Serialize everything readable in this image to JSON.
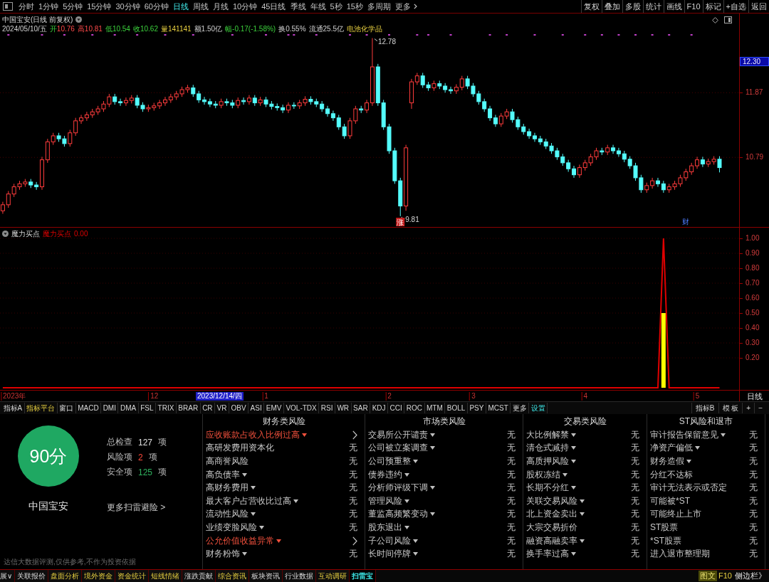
{
  "toolbar": {
    "periods": [
      {
        "label": "分时",
        "selected": false
      },
      {
        "label": "1分钟",
        "selected": false
      },
      {
        "label": "5分钟",
        "selected": false
      },
      {
        "label": "15分钟",
        "selected": false
      },
      {
        "label": "30分钟",
        "selected": false
      },
      {
        "label": "60分钟",
        "selected": false
      },
      {
        "label": "日线",
        "selected": true
      },
      {
        "label": "周线",
        "selected": false
      },
      {
        "label": "月线",
        "selected": false
      },
      {
        "label": "10分钟",
        "selected": false
      },
      {
        "label": "45日线",
        "selected": false
      },
      {
        "label": "季线",
        "selected": false
      },
      {
        "label": "年线",
        "selected": false
      },
      {
        "label": "5秒",
        "selected": false
      },
      {
        "label": "15秒",
        "selected": false
      },
      {
        "label": "多周期",
        "selected": false
      }
    ],
    "more": "更多",
    "actions": [
      "复权",
      "叠加",
      "多股",
      "统计",
      "画线",
      "F10",
      "标记",
      "+自选",
      "返回"
    ]
  },
  "stock_chart": {
    "title": "中国宝安(日线 前复权)",
    "quote": [
      {
        "value": "2024/05/10/五",
        "kind": "neutral"
      },
      {
        "label": "开",
        "value": "10.76",
        "kind": "open"
      },
      {
        "label": "高",
        "value": "10.81",
        "kind": "up"
      },
      {
        "label": "低",
        "value": "10.54",
        "kind": "down"
      },
      {
        "label": "收",
        "value": "10.62",
        "kind": "down"
      },
      {
        "label": "量",
        "value": "141141",
        "kind": "volume"
      },
      {
        "label": "额",
        "value": "1.50亿",
        "kind": "neutral"
      },
      {
        "label": "幅",
        "value": "-0.17(-1.58%)",
        "kind": "down"
      },
      {
        "label": "换",
        "value": "0.55%",
        "kind": "neutral"
      },
      {
        "label": "流通",
        "value": "25.5亿",
        "kind": "neutral"
      },
      {
        "value": "电池化学品",
        "kind": "sector"
      }
    ],
    "price_readout": "12.30",
    "chart_data": [
      {
        "type": "candlestick",
        "ylim": [
          9.63,
          13.19
        ],
        "yticks": [
          11.87,
          10.79
        ],
        "grid": true,
        "annotations": [
          "12.78",
          "9.81",
          "涨",
          "财"
        ],
        "ohlc": [
          [
            9.9,
            10.05,
            9.85,
            10.0
          ],
          [
            10.0,
            10.23,
            9.95,
            10.18
          ],
          [
            10.18,
            10.35,
            10.13,
            10.3
          ],
          [
            10.3,
            10.4,
            10.25,
            10.35
          ],
          [
            10.35,
            10.43,
            10.3,
            10.38
          ],
          [
            10.38,
            10.43,
            10.28,
            10.33
          ],
          [
            10.33,
            10.38,
            10.25,
            10.3
          ],
          [
            10.3,
            10.8,
            10.25,
            10.75
          ],
          [
            10.75,
            11.1,
            10.7,
            11.05
          ],
          [
            11.05,
            11.2,
            11.0,
            11.15
          ],
          [
            11.15,
            11.2,
            11.05,
            11.1
          ],
          [
            11.1,
            11.15,
            10.97,
            11.02
          ],
          [
            11.02,
            11.25,
            10.97,
            11.2
          ],
          [
            11.2,
            11.45,
            11.15,
            11.4
          ],
          [
            11.4,
            11.5,
            11.35,
            11.45
          ],
          [
            11.45,
            11.55,
            11.4,
            11.5
          ],
          [
            11.5,
            11.6,
            11.45,
            11.55
          ],
          [
            11.55,
            11.65,
            11.5,
            11.6
          ],
          [
            11.6,
            11.73,
            11.55,
            11.68
          ],
          [
            11.68,
            11.85,
            11.63,
            11.8
          ],
          [
            11.8,
            11.85,
            11.67,
            11.72
          ],
          [
            11.72,
            11.77,
            11.65,
            11.7
          ],
          [
            11.7,
            11.79,
            11.65,
            11.74
          ],
          [
            11.74,
            11.83,
            11.69,
            11.78
          ],
          [
            11.78,
            11.83,
            11.61,
            11.66
          ],
          [
            11.66,
            11.71,
            11.55,
            11.6
          ],
          [
            11.6,
            11.67,
            11.55,
            11.62
          ],
          [
            11.62,
            11.7,
            11.57,
            11.65
          ],
          [
            11.65,
            11.75,
            11.6,
            11.7
          ],
          [
            11.7,
            11.8,
            11.65,
            11.75
          ],
          [
            11.75,
            11.85,
            11.7,
            11.8
          ],
          [
            11.8,
            11.9,
            11.75,
            11.85
          ],
          [
            11.85,
            11.97,
            11.8,
            11.92
          ],
          [
            11.92,
            12.0,
            11.87,
            11.95
          ],
          [
            11.95,
            12.0,
            11.8,
            11.85
          ],
          [
            11.85,
            11.9,
            11.7,
            11.75
          ],
          [
            11.75,
            11.8,
            11.67,
            11.72
          ],
          [
            11.72,
            11.77,
            11.63,
            11.68
          ],
          [
            11.68,
            11.73,
            11.61,
            11.66
          ],
          [
            11.66,
            11.77,
            11.61,
            11.72
          ],
          [
            11.72,
            11.77,
            11.65,
            11.7
          ],
          [
            11.7,
            11.75,
            11.61,
            11.66
          ],
          [
            11.66,
            11.79,
            11.61,
            11.74
          ],
          [
            11.74,
            11.79,
            11.67,
            11.72
          ],
          [
            11.72,
            11.83,
            11.67,
            11.78
          ],
          [
            11.78,
            11.83,
            11.65,
            11.7
          ],
          [
            11.7,
            11.8,
            11.65,
            11.75
          ],
          [
            11.75,
            11.8,
            11.63,
            11.68
          ],
          [
            11.68,
            11.73,
            11.59,
            11.64
          ],
          [
            11.64,
            11.69,
            11.57,
            11.62
          ],
          [
            11.62,
            11.67,
            11.53,
            11.58
          ],
          [
            11.58,
            11.71,
            11.53,
            11.66
          ],
          [
            11.66,
            11.71,
            11.6,
            11.65
          ],
          [
            11.65,
            11.75,
            11.6,
            11.7
          ],
          [
            11.7,
            11.81,
            11.65,
            11.76
          ],
          [
            11.76,
            11.81,
            11.67,
            11.72
          ],
          [
            11.72,
            11.77,
            11.63,
            11.68
          ],
          [
            11.68,
            11.73,
            11.55,
            11.6
          ],
          [
            11.6,
            11.65,
            11.47,
            11.52
          ],
          [
            11.52,
            11.57,
            11.4,
            11.45
          ],
          [
            11.45,
            11.5,
            11.25,
            11.3
          ],
          [
            11.3,
            11.35,
            11.1,
            11.15
          ],
          [
            11.15,
            11.45,
            11.1,
            11.4
          ],
          [
            11.4,
            11.65,
            11.35,
            11.6
          ],
          [
            11.6,
            11.65,
            11.53,
            11.58
          ],
          [
            11.58,
            11.75,
            11.53,
            11.7
          ],
          [
            11.7,
            12.78,
            11.65,
            12.3
          ],
          [
            12.3,
            12.35,
            11.65,
            11.7
          ],
          [
            11.7,
            11.75,
            11.25,
            11.3
          ],
          [
            11.3,
            11.35,
            10.85,
            10.9
          ],
          [
            10.9,
            10.95,
            10.35,
            10.4
          ],
          [
            10.4,
            10.45,
            9.81,
            9.98
          ],
          [
            9.98,
            11.0,
            9.9,
            10.95
          ],
          [
            11.7,
            12.1,
            11.6,
            12.05
          ],
          [
            12.05,
            12.2,
            12.0,
            12.15
          ],
          [
            12.15,
            12.2,
            11.95,
            12.0
          ],
          [
            12.0,
            12.05,
            11.9,
            11.95
          ],
          [
            11.95,
            12.07,
            11.9,
            12.02
          ],
          [
            12.02,
            12.07,
            11.93,
            11.98
          ],
          [
            11.98,
            12.03,
            11.87,
            11.92
          ],
          [
            11.92,
            11.97,
            11.85,
            11.9
          ],
          [
            11.9,
            12.01,
            11.85,
            11.96
          ],
          [
            11.96,
            12.15,
            11.91,
            12.1
          ],
          [
            12.1,
            12.15,
            11.93,
            11.98
          ],
          [
            11.98,
            12.03,
            11.8,
            11.85
          ],
          [
            11.85,
            11.9,
            11.67,
            11.72
          ],
          [
            11.72,
            11.77,
            11.55,
            11.6
          ],
          [
            11.6,
            11.65,
            11.4,
            11.45
          ],
          [
            11.45,
            11.5,
            11.3,
            11.35
          ],
          [
            11.35,
            11.53,
            11.3,
            11.48
          ],
          [
            11.48,
            11.6,
            11.43,
            11.55
          ],
          [
            11.55,
            11.6,
            11.37,
            11.42
          ],
          [
            11.42,
            11.47,
            11.25,
            11.3
          ],
          [
            11.3,
            11.35,
            11.17,
            11.22
          ],
          [
            11.22,
            11.27,
            11.1,
            11.15
          ],
          [
            11.15,
            11.2,
            11.05,
            11.1
          ],
          [
            11.1,
            11.15,
            11.0,
            11.05
          ],
          [
            11.05,
            11.1,
            10.93,
            10.98
          ],
          [
            10.98,
            11.03,
            10.85,
            10.9
          ],
          [
            10.9,
            10.95,
            10.75,
            10.8
          ],
          [
            10.8,
            10.85,
            10.65,
            10.7
          ],
          [
            10.7,
            10.75,
            10.55,
            10.6
          ],
          [
            10.6,
            10.65,
            10.45,
            10.5
          ],
          [
            10.5,
            10.67,
            10.45,
            10.62
          ],
          [
            10.62,
            10.75,
            10.57,
            10.7
          ],
          [
            10.7,
            10.85,
            10.65,
            10.8
          ],
          [
            10.8,
            10.95,
            10.75,
            10.9
          ],
          [
            10.9,
            10.95,
            10.83,
            10.88
          ],
          [
            10.88,
            11.0,
            10.83,
            10.95
          ],
          [
            10.95,
            11.0,
            10.85,
            10.9
          ],
          [
            10.9,
            10.95,
            10.8,
            10.85
          ],
          [
            10.85,
            10.9,
            10.71,
            10.76
          ],
          [
            10.76,
            10.81,
            10.6,
            10.65
          ],
          [
            10.65,
            10.7,
            10.4,
            10.45
          ],
          [
            10.45,
            10.5,
            10.2,
            10.25
          ],
          [
            10.25,
            10.37,
            10.2,
            10.32
          ],
          [
            10.32,
            10.45,
            10.27,
            10.4
          ],
          [
            10.4,
            10.45,
            10.3,
            10.35
          ],
          [
            10.35,
            10.4,
            10.2,
            10.25
          ],
          [
            10.25,
            10.35,
            10.2,
            10.3
          ],
          [
            10.3,
            10.4,
            10.25,
            10.35
          ],
          [
            10.35,
            10.5,
            10.3,
            10.45
          ],
          [
            10.45,
            10.6,
            10.4,
            10.55
          ],
          [
            10.55,
            10.7,
            10.5,
            10.65
          ],
          [
            10.65,
            10.8,
            10.6,
            10.75
          ],
          [
            10.75,
            10.8,
            10.63,
            10.68
          ],
          [
            10.68,
            10.77,
            10.63,
            10.72
          ],
          [
            10.72,
            10.81,
            10.67,
            10.76
          ],
          [
            10.76,
            10.81,
            10.54,
            10.62
          ],
          null,
          null,
          null
        ]
      }
    ]
  },
  "indicator": {
    "title": "魔力买点",
    "reading": "0.00",
    "cursor_date": "2023/12/14/四",
    "axis_period": "日线",
    "chart_data": [
      {
        "type": "line",
        "ylim": [
          0,
          1.07
        ],
        "grid": true,
        "yticks": [
          {
            "value": 1,
            "label": "1.00"
          },
          {
            "value": 0.9,
            "label": "0.90"
          },
          {
            "value": 0.8,
            "label": "0.80"
          },
          {
            "value": 0.7,
            "label": "0.70"
          },
          {
            "value": 0.6,
            "label": "0.60"
          },
          {
            "value": 0.5,
            "label": "0.50"
          },
          {
            "value": 0.4,
            "label": "0.40"
          },
          {
            "value": 0.3,
            "label": "0.30"
          },
          {
            "value": 0.2,
            "label": "0.20"
          }
        ],
        "categories": [
          null,
          null,
          "2023年",
          null,
          null,
          null,
          null,
          null,
          null,
          null,
          null,
          null,
          null,
          null,
          null,
          null,
          null,
          null,
          null,
          null,
          null,
          null,
          null,
          null,
          null,
          null,
          null,
          "12",
          null,
          null,
          null,
          null,
          null,
          null,
          null,
          null,
          null,
          null,
          null,
          null,
          null,
          null,
          null,
          null,
          null,
          null,
          null,
          "1",
          null,
          null,
          null,
          null,
          null,
          null,
          null,
          null,
          null,
          null,
          null,
          null,
          null,
          null,
          null,
          null,
          null,
          null,
          null,
          null,
          null,
          "2",
          null,
          null,
          null,
          null,
          null,
          null,
          null,
          null,
          null,
          null,
          null,
          null,
          null,
          null,
          "3",
          null,
          null,
          null,
          null,
          null,
          null,
          null,
          null,
          null,
          null,
          null,
          null,
          null,
          null,
          null,
          null,
          null,
          null,
          null,
          "4",
          null,
          null,
          null,
          null,
          null,
          null,
          null,
          null,
          null,
          null,
          null,
          null,
          null,
          null,
          null,
          null,
          null,
          null,
          null,
          "5",
          null,
          null,
          null,
          null,
          null,
          null,
          null
        ],
        "series": [
          {
            "name": "魔力买点",
            "color": "#e00000",
            "values": [
              0,
              0,
              0,
              0,
              0,
              0,
              0,
              0,
              0,
              0,
              0,
              0,
              0,
              0,
              0,
              0,
              0,
              0,
              0,
              0,
              0,
              0,
              0,
              0,
              0,
              0,
              0,
              0,
              0,
              0,
              0,
              0,
              0,
              0,
              0,
              0,
              0,
              0,
              0,
              0,
              0,
              0,
              0,
              0,
              0,
              0,
              0,
              0,
              0,
              0,
              0,
              0,
              0,
              0,
              0,
              0,
              0,
              0,
              0,
              0,
              0,
              0,
              0,
              0,
              0,
              0,
              0,
              0,
              0,
              0,
              0,
              0,
              0,
              0,
              0,
              0,
              0,
              0,
              0,
              0,
              0,
              0,
              0,
              0,
              0,
              0,
              0,
              0,
              0,
              0,
              0,
              0,
              0,
              0,
              0,
              0,
              0,
              0,
              0,
              0,
              0,
              0,
              0,
              0,
              0,
              0,
              0,
              0,
              0,
              0,
              0,
              0,
              0,
              0,
              0,
              0,
              0,
              0,
              1,
              0,
              0,
              0,
              0,
              0,
              0,
              0,
              0,
              0,
              0,
              null,
              null,
              null
            ]
          },
          {
            "type": "bar",
            "color": "#ffff00",
            "values": [
              null,
              null,
              null,
              null,
              null,
              null,
              null,
              null,
              null,
              null,
              null,
              null,
              null,
              null,
              null,
              null,
              null,
              null,
              null,
              null,
              null,
              null,
              null,
              null,
              null,
              null,
              null,
              null,
              null,
              null,
              null,
              null,
              null,
              null,
              null,
              null,
              null,
              null,
              null,
              null,
              null,
              null,
              null,
              null,
              null,
              null,
              null,
              null,
              null,
              null,
              null,
              null,
              null,
              null,
              null,
              null,
              null,
              null,
              null,
              null,
              null,
              null,
              null,
              null,
              null,
              null,
              null,
              null,
              null,
              null,
              null,
              null,
              null,
              null,
              null,
              null,
              null,
              null,
              null,
              null,
              null,
              null,
              null,
              null,
              null,
              null,
              null,
              null,
              null,
              null,
              null,
              null,
              null,
              null,
              null,
              null,
              null,
              null,
              null,
              null,
              null,
              null,
              null,
              null,
              null,
              null,
              null,
              null,
              null,
              null,
              null,
              null,
              null,
              null,
              null,
              null,
              null,
              null,
              0.5,
              null,
              null,
              null,
              null,
              null,
              null,
              null,
              null,
              null,
              null,
              null,
              null,
              null
            ]
          }
        ]
      }
    ]
  },
  "indicator_tabs": {
    "left": [
      {
        "label": "指标A",
        "kind": "plain"
      },
      {
        "label": "指标平台",
        "kind": "highlight"
      },
      {
        "label": "窗口",
        "kind": "plain"
      },
      {
        "label": "MACD",
        "kind": "plain"
      },
      {
        "label": "DMI",
        "kind": "plain"
      },
      {
        "label": "DMA",
        "kind": "plain"
      },
      {
        "label": "FSL",
        "kind": "plain"
      },
      {
        "label": "TRIX",
        "kind": "plain"
      },
      {
        "label": "BRAR",
        "kind": "plain"
      },
      {
        "label": "CR",
        "kind": "plain"
      },
      {
        "label": "VR",
        "kind": "plain"
      },
      {
        "label": "OBV",
        "kind": "plain"
      },
      {
        "label": "ASI",
        "kind": "plain"
      },
      {
        "label": "EMV",
        "kind": "plain"
      },
      {
        "label": "VOL-TDX",
        "kind": "plain"
      },
      {
        "label": "RSI",
        "kind": "plain"
      },
      {
        "label": "WR",
        "kind": "plain"
      },
      {
        "label": "SAR",
        "kind": "plain"
      },
      {
        "label": "KDJ",
        "kind": "plain"
      },
      {
        "label": "CCI",
        "kind": "plain"
      },
      {
        "label": "ROC",
        "kind": "plain"
      },
      {
        "label": "MTM",
        "kind": "plain"
      },
      {
        "label": "BOLL",
        "kind": "plain"
      },
      {
        "label": "PSY",
        "kind": "plain"
      },
      {
        "label": "MCST",
        "kind": "plain"
      },
      {
        "label": "更多",
        "kind": "plain"
      },
      {
        "label": "设置",
        "kind": "accent"
      }
    ],
    "right": [
      "指标B",
      "模 板",
      "+",
      "−"
    ]
  },
  "risk_scan": {
    "score": "90分",
    "stock_name": "中国宝安",
    "stats": [
      {
        "label": "总检查",
        "value": "127",
        "unit": "项",
        "kind": "total"
      },
      {
        "label": "风险项",
        "value": "2",
        "unit": "项",
        "kind": "risk"
      },
      {
        "label": "安全项",
        "value": "125",
        "unit": "项",
        "kind": "safe"
      }
    ],
    "more_link": "更多扫雷避险 >",
    "disclaimer": "达信大数据评测,仅供参考,不作为投资依据",
    "categories": [
      {
        "title": "财务类风险",
        "items": [
          {
            "name": "应收账款占收入比例过高",
            "expandable": true,
            "flagged": true
          },
          {
            "name": "高研发费用资本化",
            "expandable": false,
            "flagged": false,
            "result": "无"
          },
          {
            "name": "高商誉风险",
            "expandable": false,
            "flagged": false,
            "result": "无"
          },
          {
            "name": "高负债率",
            "expandable": true,
            "flagged": false,
            "result": "无"
          },
          {
            "name": "高财务费用",
            "expandable": true,
            "flagged": false,
            "result": "无"
          },
          {
            "name": "最大客户占营收比过高",
            "expandable": true,
            "flagged": false,
            "result": "无"
          },
          {
            "name": "流动性风险",
            "expandable": true,
            "flagged": false,
            "result": "无"
          },
          {
            "name": "业绩变脸风险",
            "expandable": true,
            "flagged": false,
            "result": "无"
          },
          {
            "name": "公允价值收益异常",
            "expandable": true,
            "flagged": true
          },
          {
            "name": "财务粉饰",
            "expandable": true,
            "flagged": false,
            "result": "无"
          }
        ]
      },
      {
        "title": "市场类风险",
        "items": [
          {
            "name": "交易所公开谴责",
            "expandable": true,
            "flagged": false,
            "result": "无"
          },
          {
            "name": "公司被立案调查",
            "expandable": true,
            "flagged": false,
            "result": "无"
          },
          {
            "name": "公司预重整",
            "expandable": true,
            "flagged": false,
            "result": "无"
          },
          {
            "name": "债券违约",
            "expandable": true,
            "flagged": false,
            "result": "无"
          },
          {
            "name": "分析师评级下调",
            "expandable": true,
            "flagged": false,
            "result": "无"
          },
          {
            "name": "管理风险",
            "expandable": true,
            "flagged": false,
            "result": "无"
          },
          {
            "name": "董监高频繁变动",
            "expandable": true,
            "flagged": false,
            "result": "无"
          },
          {
            "name": "股东退出",
            "expandable": true,
            "flagged": false,
            "result": "无"
          },
          {
            "name": "子公司风险",
            "expandable": true,
            "flagged": false,
            "result": "无"
          },
          {
            "name": "长时间停牌",
            "expandable": true,
            "flagged": false,
            "result": "无"
          }
        ]
      },
      {
        "title": "交易类风险",
        "items": [
          {
            "name": "大比例解禁",
            "expandable": true,
            "flagged": false,
            "result": "无"
          },
          {
            "name": "清仓式减持",
            "expandable": true,
            "flagged": false,
            "result": "无"
          },
          {
            "name": "高质押风险",
            "expandable": true,
            "flagged": false,
            "result": "无"
          },
          {
            "name": "股权冻结",
            "expandable": true,
            "flagged": false,
            "result": "无"
          },
          {
            "name": "长期不分红",
            "expandable": true,
            "flagged": false,
            "result": "无"
          },
          {
            "name": "关联交易风险",
            "expandable": true,
            "flagged": false,
            "result": "无"
          },
          {
            "name": "北上资金卖出",
            "expandable": true,
            "flagged": false,
            "result": "无"
          },
          {
            "name": "大宗交易折价",
            "expandable": false,
            "flagged": false,
            "result": "无"
          },
          {
            "name": "融资高融卖率",
            "expandable": true,
            "flagged": false,
            "result": "无"
          },
          {
            "name": "换手率过高",
            "expandable": true,
            "flagged": false,
            "result": "无"
          }
        ]
      },
      {
        "title": "ST风险和退市",
        "items": [
          {
            "name": "审计报告保留意见",
            "expandable": true,
            "flagged": false,
            "result": "无"
          },
          {
            "name": "净资产偏低",
            "expandable": true,
            "flagged": false,
            "result": "无"
          },
          {
            "name": "财务造假",
            "expandable": true,
            "flagged": false,
            "result": "无"
          },
          {
            "name": "分红不达标",
            "expandable": false,
            "flagged": false,
            "result": "无"
          },
          {
            "name": "审计无法表示或否定",
            "expandable": false,
            "flagged": false,
            "result": "无"
          },
          {
            "name": "可能被*ST",
            "expandable": false,
            "flagged": false,
            "result": "无"
          },
          {
            "name": "可能终止上市",
            "expandable": false,
            "flagged": false,
            "result": "无"
          },
          {
            "name": "ST股票",
            "expandable": false,
            "flagged": false,
            "result": "无"
          },
          {
            "name": "*ST股票",
            "expandable": false,
            "flagged": false,
            "result": "无"
          },
          {
            "name": "进入退市整理期",
            "expandable": false,
            "flagged": false,
            "result": "无"
          }
        ]
      }
    ]
  },
  "bottom_tabs": {
    "items": [
      {
        "label": "展∨",
        "kind": "plain",
        "selected": false
      },
      {
        "label": "关联报价",
        "kind": "plain",
        "selected": false
      },
      {
        "label": "盘面分析",
        "kind": "highlight",
        "selected": false
      },
      {
        "label": "境外资金",
        "kind": "highlight",
        "selected": false
      },
      {
        "label": "资金统计",
        "kind": "highlight",
        "selected": false
      },
      {
        "label": "短线情绪",
        "kind": "highlight",
        "selected": false
      },
      {
        "label": "涨跌贡献",
        "kind": "plain",
        "selected": false
      },
      {
        "label": "综合资讯",
        "kind": "highlight",
        "selected": false
      },
      {
        "label": "板块资讯",
        "kind": "plain",
        "selected": false
      },
      {
        "label": "行业数据",
        "kind": "plain",
        "selected": false
      },
      {
        "label": "互动调研",
        "kind": "highlight",
        "selected": false
      },
      {
        "label": "扫雷宝",
        "kind": "accent",
        "selected": true
      }
    ],
    "right": [
      {
        "label": "图文",
        "kind": "badge"
      },
      {
        "label": "F10",
        "kind": "highlight"
      },
      {
        "label": "侧边栏》",
        "kind": "plain"
      }
    ]
  }
}
